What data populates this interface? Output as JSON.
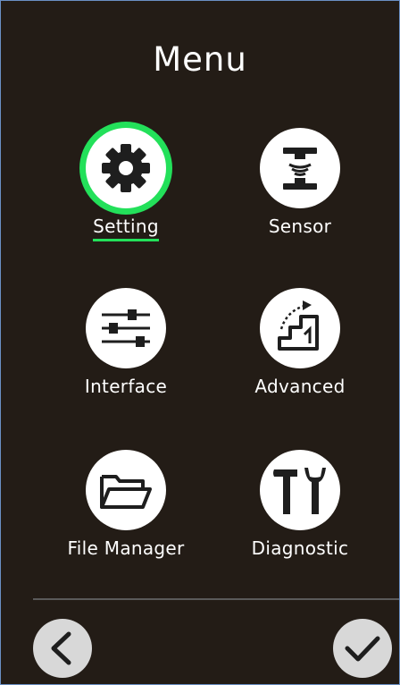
{
  "title": "Menu",
  "menu": {
    "items": [
      {
        "label": "Setting",
        "icon": "gear-icon",
        "selected": true
      },
      {
        "label": "Sensor",
        "icon": "sensor-icon",
        "selected": false
      },
      {
        "label": "Interface",
        "icon": "sliders-icon",
        "selected": false
      },
      {
        "label": "Advanced",
        "icon": "stairs-icon",
        "selected": false
      },
      {
        "label": "File Manager",
        "icon": "folder-icon",
        "selected": false
      },
      {
        "label": "Diagnostic",
        "icon": "tools-icon",
        "selected": false
      }
    ]
  },
  "nav": {
    "back_icon": "back-arrow-icon",
    "confirm_icon": "checkmark-icon"
  },
  "colors": {
    "background": "#231c16",
    "selection": "#23e05a",
    "icon_circle": "#ffffff",
    "nav_button": "#d8d8d8"
  }
}
